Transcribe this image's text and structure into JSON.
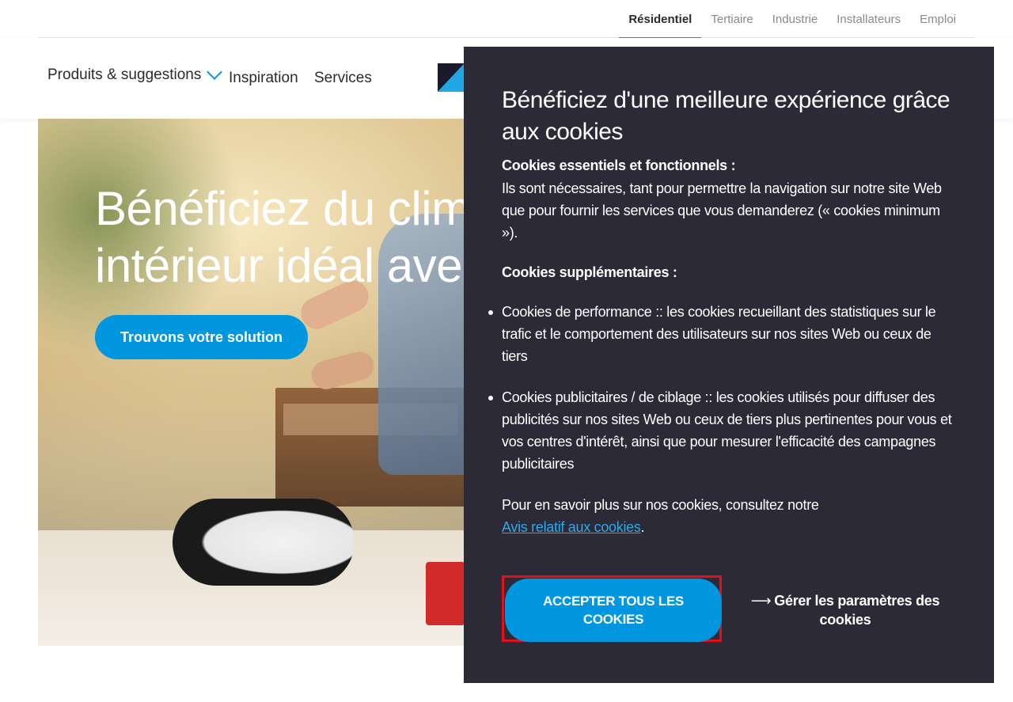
{
  "topbar": {
    "links": [
      {
        "label": "Résidentiel",
        "active": true
      },
      {
        "label": "Tertiaire"
      },
      {
        "label": "Industrie"
      },
      {
        "label": "Installateurs"
      },
      {
        "label": "Emploi"
      }
    ]
  },
  "nav": {
    "products": "Produits & suggestions",
    "inspiration": "Inspiration",
    "services": "Services"
  },
  "hero": {
    "heading_line1": "Bénéficiez du climat",
    "heading_line2": "intérieur idéal avec D",
    "cta": "Trouvons votre solution"
  },
  "cookie_modal": {
    "title": "Bénéficiez d'une meilleure expérience grâce aux cookies",
    "essential_heading": "Cookies essentiels et fonctionnels :",
    "essential_text": "Ils sont nécessaires, tant pour permettre la navigation sur notre site Web que pour fournir les services que vous demanderez (« cookies minimum »).",
    "additional_heading": "Cookies supplémentaires :",
    "bullets": [
      "Cookies de performance :: les cookies recueillant des statistiques sur le trafic et le comportement des utilisateurs sur nos sites Web ou ceux de tiers",
      "Cookies publicitaires / de ciblage :: les cookies utilisés pour diffuser des publicités sur nos sites Web ou ceux de tiers plus pertinentes pour vous et vos centres d'intérêt, ainsi que pour mesurer l'efficacité des campagnes publicitaires"
    ],
    "more_info_text": "Pour en savoir plus sur nos cookies, consultez notre",
    "notice_link": "Avis relatif aux cookies",
    "notice_period": ".",
    "accept_button": "ACCEPTER TOUS LES COOKIES",
    "manage_arrow": "⟶",
    "manage_link": "Gérer les paramètres des cookies"
  },
  "colors": {
    "accent": "#0097e0",
    "modal_bg": "#2b2a36",
    "highlight_frame": "#e3101c"
  }
}
